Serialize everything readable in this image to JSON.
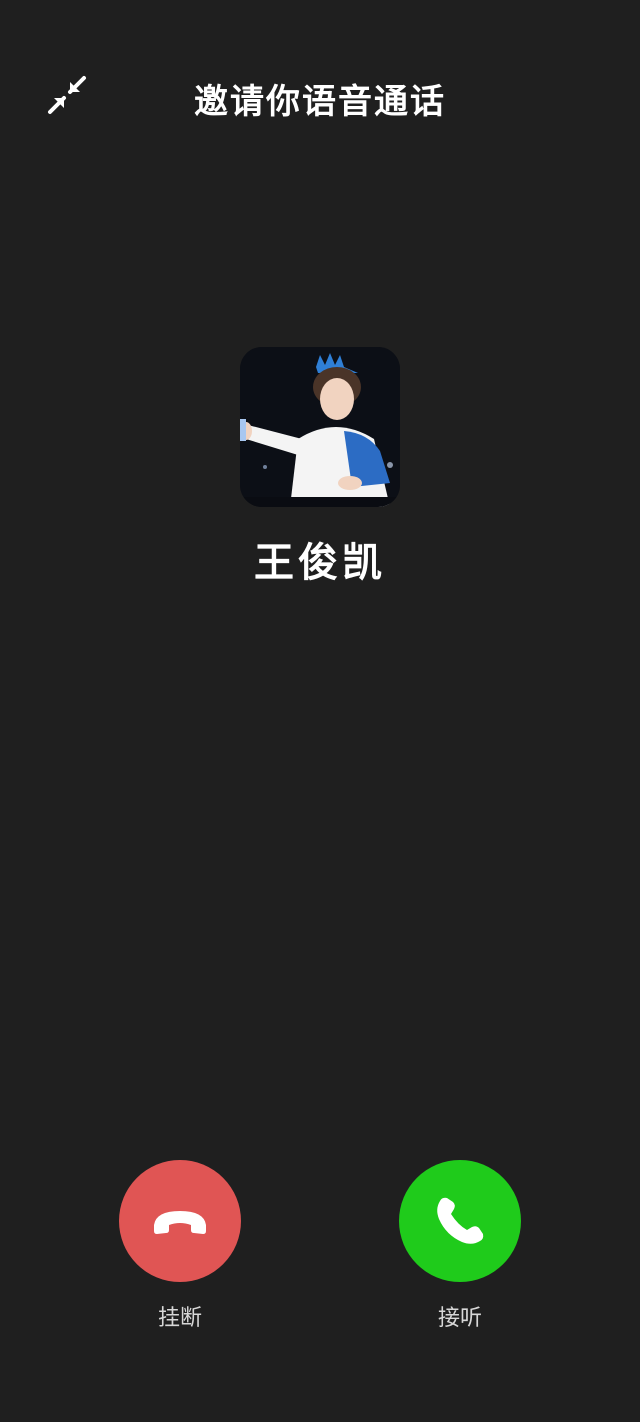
{
  "header": {
    "title": "邀请你语音通话",
    "minimize_icon": "minimize-arrows-icon"
  },
  "caller": {
    "name": "王俊凯",
    "avatar": "avatar-photo"
  },
  "actions": {
    "hangup": {
      "label": "挂断",
      "icon": "phone-hangup-icon",
      "color": "#e05554"
    },
    "answer": {
      "label": "接听",
      "icon": "phone-answer-icon",
      "color": "#1fcb1b"
    }
  },
  "colors": {
    "background": "#1f1f1f",
    "text": "#ffffff",
    "label": "#d8d8d8"
  }
}
